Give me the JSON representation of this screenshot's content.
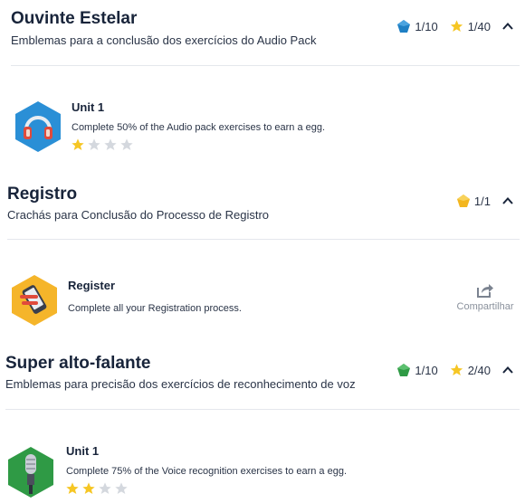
{
  "sections": [
    {
      "title": "Ouvinte Estelar",
      "subtitle": "Emblemas para a conclusão dos exercícios do Audio Pack",
      "stats": [
        {
          "icon": "blue-gem-icon",
          "value": "1/10"
        },
        {
          "icon": "star-icon",
          "value": "1/40"
        }
      ],
      "badge": {
        "icon": "headphones-badge-icon",
        "title": "Unit 1",
        "description": "Complete 50% of the Audio pack exercises to earn a egg.",
        "stars_earned": 1,
        "stars_total": 4
      }
    },
    {
      "title": "Registro",
      "subtitle": "Crachás para Conclusão do Processo de Registro",
      "stats": [
        {
          "icon": "gold-gem-icon",
          "value": "1/1"
        }
      ],
      "badge": {
        "icon": "register-phone-badge-icon",
        "title": "Register",
        "description": "Complete all your Registration process.",
        "share_label": "Compartilhar"
      }
    },
    {
      "title": "Super alto-falante",
      "subtitle": "Emblemas para precisão dos exercícios de reconhecimento de voz",
      "stats": [
        {
          "icon": "green-gem-icon",
          "value": "1/10"
        },
        {
          "icon": "star-icon",
          "value": "2/40"
        }
      ],
      "badge": {
        "icon": "microphone-badge-icon",
        "title": "Unit 1",
        "description": "Complete 75% of the Voice recognition exercises to earn a egg.",
        "stars_earned": 2,
        "stars_total": 4
      }
    }
  ],
  "colors": {
    "blue_gem": "#1e7fc4",
    "gold_gem": "#f3b61f",
    "green_gem": "#2f9a45",
    "star_filled": "#f6c624",
    "star_empty": "#d4d8de"
  }
}
